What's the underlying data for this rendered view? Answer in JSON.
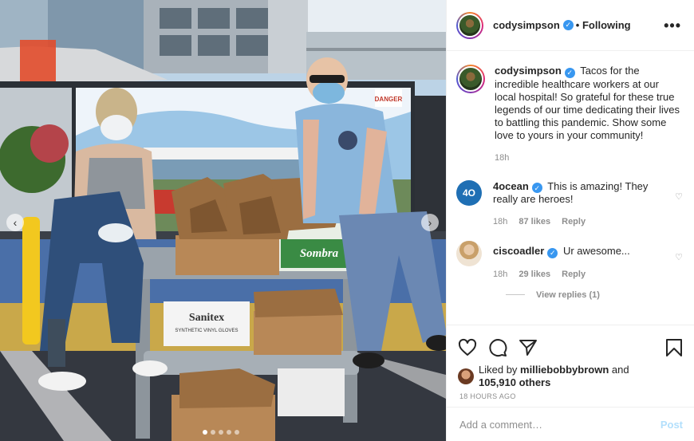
{
  "post": {
    "username": "codysimpson",
    "follow_status": "Following",
    "more_label": "•••",
    "caption": "Tacos for the incredible healthcare workers at our local hospital! So grateful for these true legends of our time dedicating their lives to battling this pandemic. Show some love to yours in your community!",
    "caption_time": "18h",
    "carousel": {
      "slides": 5,
      "active_index": 0
    }
  },
  "photo_text": {
    "box_brand": "Sanitex",
    "box_line": "SYNTHETIC VINYL GLOVES",
    "box2_brand": "Sombra",
    "sign": "DANGER"
  },
  "comments": [
    {
      "username": "4ocean",
      "avatar_initials": "4O",
      "verified": true,
      "text": "This is amazing! They really are heroes!",
      "time": "18h",
      "likes": "87 likes",
      "reply_label": "Reply"
    },
    {
      "username": "ciscoadler",
      "verified": true,
      "text": "Ur awesome...",
      "time": "18h",
      "likes": "29 likes",
      "reply_label": "Reply",
      "view_replies": "View replies (1)"
    }
  ],
  "likes": {
    "liked_by_prefix": "Liked by",
    "liked_by_user": "milliebobbybrown",
    "and_label": "and",
    "others": "105,910 others"
  },
  "timestamp": "18 HOURS AGO",
  "add_comment": {
    "placeholder": "Add a comment…",
    "post_label": "Post"
  },
  "colors": {
    "verified": "#3897f0",
    "post_button_disabled": "#b2dffc",
    "meta_gray": "#8e8e8e"
  }
}
